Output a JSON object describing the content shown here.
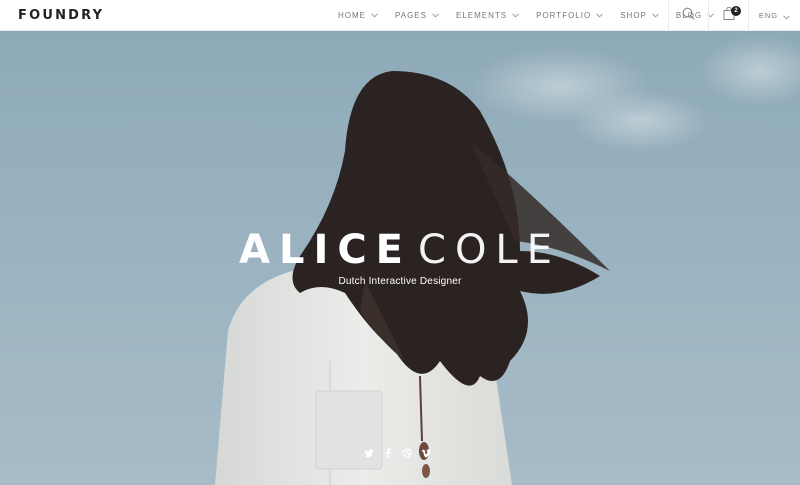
{
  "brand": {
    "logo": "FOUNDRY"
  },
  "nav": {
    "items": [
      {
        "label": "HOME"
      },
      {
        "label": "PAGES"
      },
      {
        "label": "ELEMENTS"
      },
      {
        "label": "PORTFOLIO"
      },
      {
        "label": "SHOP"
      },
      {
        "label": "BLOG"
      }
    ],
    "cart_count": "2",
    "language": "ENG"
  },
  "hero": {
    "first_name": "ALICE",
    "last_name": "COLE",
    "subtitle": "Dutch Interactive Designer"
  },
  "social": [
    "twitter-icon",
    "facebook-icon",
    "dribbble-icon",
    "vimeo-icon"
  ],
  "colors": {
    "nav_text": "#777777",
    "hero_sky": "#9db5c3",
    "text_light": "#ffffff"
  }
}
